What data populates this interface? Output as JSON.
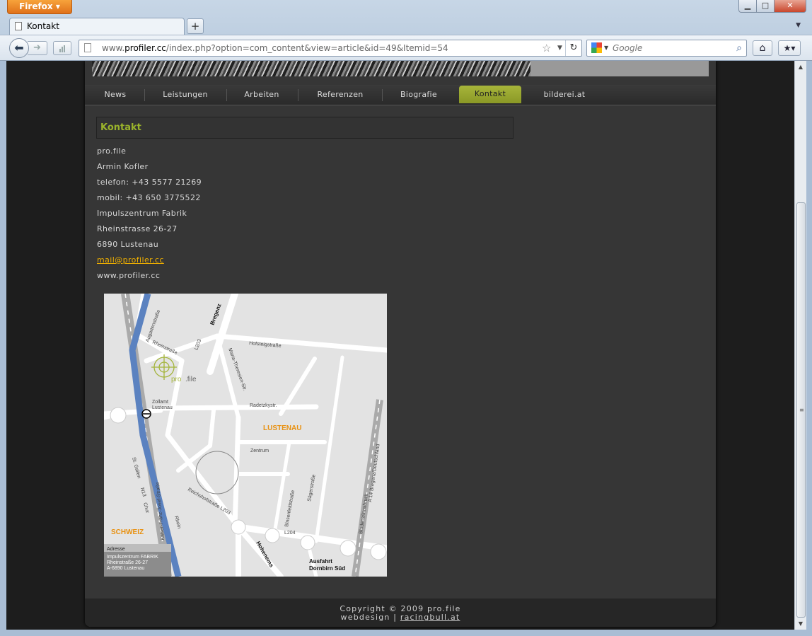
{
  "browser": {
    "app_button": "Firefox",
    "tab_title": "Kontakt",
    "new_tab": "+",
    "url_host": "www.profiler.cc",
    "url_prefix": "www.",
    "url_domain": "profiler.cc",
    "url_path": "/index.php?option=com_content&view=article&id=49&Itemid=54",
    "search_placeholder": "Google"
  },
  "site": {
    "menu": [
      "News",
      "Leistungen",
      "Arbeiten",
      "Referenzen",
      "Biografie",
      "Kontakt",
      "bilderei.at"
    ],
    "active_menu": "Kontakt",
    "heading": "Kontakt",
    "contact": {
      "company": "pro.file",
      "name": "Armin Kofler",
      "phone": "telefon: +43 5577 21269",
      "mobile": "mobil: +43 650 3775522",
      "building": "Impulszentrum Fabrik",
      "street": "Rheinstrasse 26-27",
      "city": "6890 Lustenau",
      "email": "mail@profiler.cc",
      "web": "www.profiler.cc"
    },
    "map": {
      "labels": {
        "bregenz": "Bregenz",
        "ausgarten": "Augartenstraße",
        "rhein1": "Rheinstraße",
        "l203": "L203",
        "hofsteig": "Hofsteigstraße",
        "maria": "Maria-Theresien-Str.",
        "logo_pro": "pro",
        "logo_file": ".file",
        "zollamt": "Zollamt",
        "zollamt2": "Lustenau",
        "radetzky": "Radetzkystr.",
        "lustenau": "LUSTENAU",
        "zentrum": "Zentrum",
        "stgallen": "St. Gallen",
        "n13": "N13",
        "chur": "Chur",
        "kaiser": "Kaiser-Franz-Josef-Straße",
        "binsenfeld": "Binsenfeldstraße",
        "saeger": "Sägerstraße",
        "a14": "A 14  Bregenz/Deutschland",
        "bludenz": "Bludenz/Innsbruck",
        "reichshof": "Reichshofstraße L203",
        "rhein": "Rhein",
        "l204": "L204",
        "schweiz": "SCHWEIZ",
        "hohenems": "Hohenems",
        "ausfahrt": "Ausfahrt",
        "ausfahrt2": "Dornbirn Süd",
        "adresse": "Adresse",
        "addr1": "Impulszentrum FABRIK",
        "addr2": "Rheinstraße 26-27",
        "addr3": "A-6890 Lustenau"
      }
    },
    "footer": {
      "copyright": "Copyright © 2009 pro.file",
      "webdesign": "webdesign | ",
      "credit": "racingbull.at"
    }
  },
  "colors": {
    "accent": "#9ab32b",
    "link": "#f0b000",
    "map_orange": "#e8900f"
  }
}
